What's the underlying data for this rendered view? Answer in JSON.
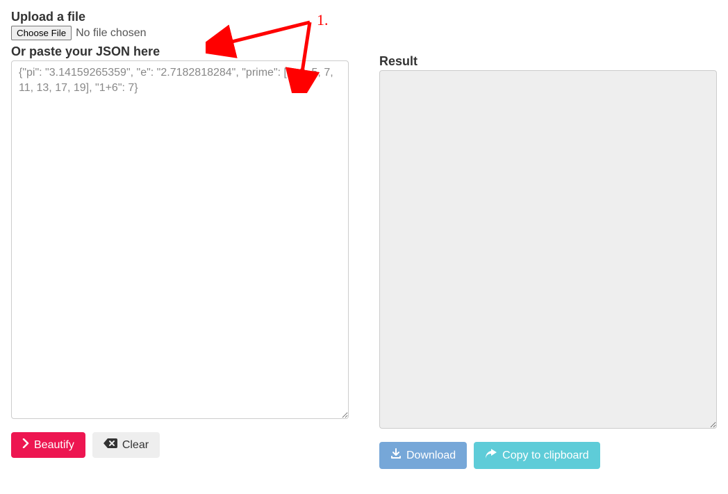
{
  "left": {
    "upload_label": "Upload a file",
    "choose_file_button": "Choose File",
    "no_file_text": "No file chosen",
    "paste_label": "Or paste your JSON here",
    "textarea_placeholder": "{\"pi\": \"3.14159265359\", \"e\": \"2.7182818284\", \"prime\": [2, 3, 5, 7, 11, 13, 17, 19], \"1+6\": 7}",
    "textarea_value": "",
    "beautify_button": "Beautify",
    "clear_button": "Clear"
  },
  "right": {
    "result_label": "Result",
    "result_value": "",
    "download_button": "Download",
    "copy_button": "Copy to clipboard"
  },
  "annotation": {
    "number": "1."
  }
}
